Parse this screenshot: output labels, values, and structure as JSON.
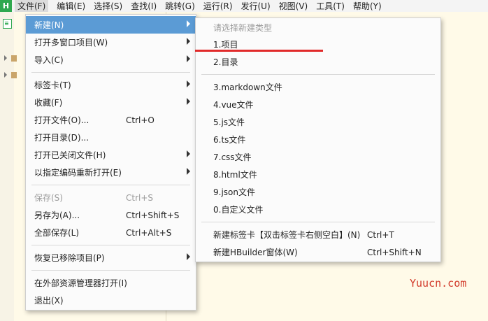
{
  "menubar": {
    "logo": "H",
    "items": [
      "文件(F)",
      "编辑(E)",
      "选择(S)",
      "查找(I)",
      "跳转(G)",
      "运行(R)",
      "发行(U)",
      "视图(V)",
      "工具(T)",
      "帮助(Y)"
    ]
  },
  "file_menu": {
    "new": "新建(N)",
    "open_multi": "打开多窗口项目(W)",
    "import": "导入(C)",
    "tabs": "标签卡(T)",
    "favorites": "收藏(F)",
    "open_file": "打开文件(O)...",
    "open_file_sc": "Ctrl+O",
    "open_dir": "打开目录(D)...",
    "open_closed": "打开已关闭文件(H)",
    "reopen_encoding": "以指定编码重新打开(E)",
    "save": "保存(S)",
    "save_sc": "Ctrl+S",
    "save_as": "另存为(A)...",
    "save_as_sc": "Ctrl+Shift+S",
    "save_all": "全部保存(L)",
    "save_all_sc": "Ctrl+Alt+S",
    "restore_removed": "恢复已移除项目(P)",
    "open_in_explorer": "在外部资源管理器打开(I)",
    "exit": "退出(X)"
  },
  "new_submenu": {
    "header": "请选择新建类型",
    "items": [
      "1.项目",
      "2.目录",
      "3.markdown文件",
      "4.vue文件",
      "5.js文件",
      "6.ts文件",
      "7.css文件",
      "8.html文件",
      "9.json文件",
      "0.自定义文件"
    ],
    "new_tab": "新建标签卡【双击标签卡右侧空白】(N)",
    "new_tab_sc": "Ctrl+T",
    "new_window": "新建HBuilder窗体(W)",
    "new_window_sc": "Ctrl+Shift+N"
  },
  "watermark": "Yuucn.com",
  "colors": {
    "highlight": "#5b9bd5",
    "annotation": "#e12a2a",
    "brand": "#2fa84f"
  }
}
